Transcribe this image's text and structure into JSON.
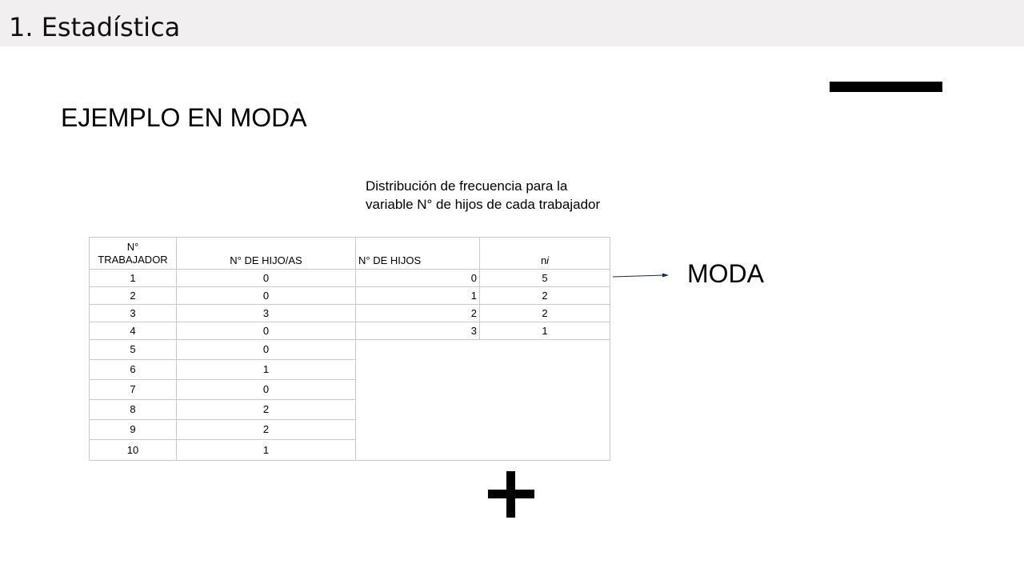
{
  "header": {
    "title": "1. Estadística"
  },
  "slide": {
    "title": "EJEMPLO EN MODA",
    "caption": "Distribución de frecuencia para la variable N°  de hijos de cada trabajador",
    "moda_label": "MODA"
  },
  "table_left": {
    "headers": {
      "col1_line1": "N°",
      "col1_line2": "TRABAJADOR",
      "col2": "N° DE HIJO/AS"
    },
    "rows": [
      {
        "trabajador": "1",
        "hijos": "0"
      },
      {
        "trabajador": "2",
        "hijos": "0"
      },
      {
        "trabajador": "3",
        "hijos": "3"
      },
      {
        "trabajador": "4",
        "hijos": "0"
      },
      {
        "trabajador": "5",
        "hijos": "0"
      },
      {
        "trabajador": "6",
        "hijos": "1"
      },
      {
        "trabajador": "7",
        "hijos": "0"
      },
      {
        "trabajador": "8",
        "hijos": "2"
      },
      {
        "trabajador": "9",
        "hijos": "2"
      },
      {
        "trabajador": "10",
        "hijos": "1"
      }
    ]
  },
  "table_freq": {
    "headers": {
      "col1": "N° DE HIJOS",
      "col2_n": "n",
      "col2_i": "i"
    },
    "rows": [
      {
        "hijos": "0",
        "ni": "5"
      },
      {
        "hijos": "1",
        "ni": "2"
      },
      {
        "hijos": "2",
        "ni": "2"
      },
      {
        "hijos": "3",
        "ni": "1"
      }
    ]
  }
}
